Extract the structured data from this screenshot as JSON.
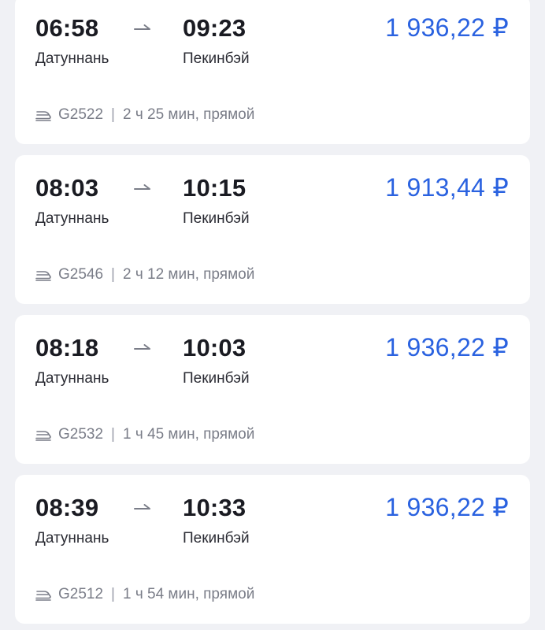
{
  "results": [
    {
      "departure_time": "06:58",
      "arrival_time": "09:23",
      "from_station": "Датуннань",
      "to_station": "Пекинбэй",
      "price": "1 936,22 ₽",
      "train_number": "G2522",
      "duration": "2 ч 25 мин, прямой"
    },
    {
      "departure_time": "08:03",
      "arrival_time": "10:15",
      "from_station": "Датуннань",
      "to_station": "Пекинбэй",
      "price": "1 913,44 ₽",
      "train_number": "G2546",
      "duration": "2 ч 12 мин, прямой"
    },
    {
      "departure_time": "08:18",
      "arrival_time": "10:03",
      "from_station": "Датуннань",
      "to_station": "Пекинбэй",
      "price": "1 936,22 ₽",
      "train_number": "G2532",
      "duration": "1 ч 45 мин, прямой"
    },
    {
      "departure_time": "08:39",
      "arrival_time": "10:33",
      "from_station": "Датуннань",
      "to_station": "Пекинбэй",
      "price": "1 936,22 ₽",
      "train_number": "G2512",
      "duration": "1 ч 54 мин, прямой"
    }
  ],
  "separator": "|",
  "icons": {
    "transport": "train-icon",
    "direction": "arrow-right-icon"
  },
  "colors": {
    "price": "#2a62e0",
    "background": "#f0f1f5",
    "card": "#ffffff"
  }
}
